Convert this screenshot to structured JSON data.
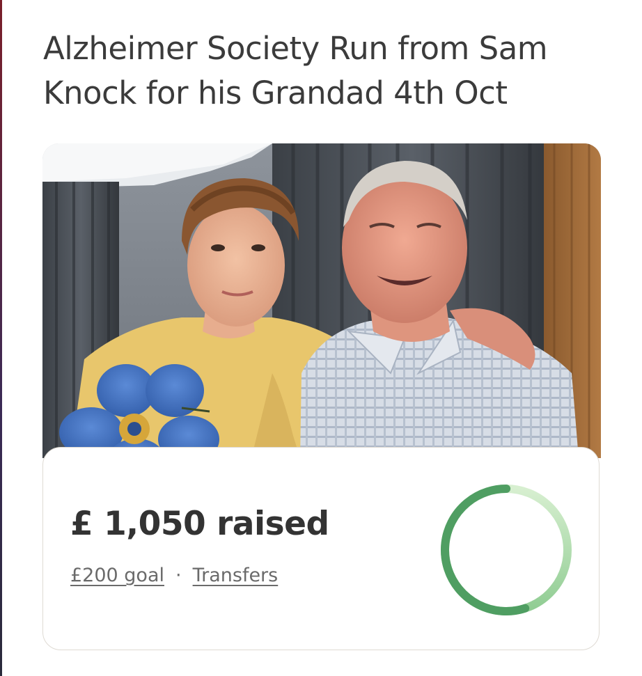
{
  "campaign": {
    "title": "Alzheimer Society Run from Sam Knock for his Grandad 4th Oct"
  },
  "progress": {
    "raised_text": "£ 1,050 raised",
    "goal_text": "£200 goal",
    "separator": "·",
    "transfers_text": "Transfers",
    "fraction": 1.0,
    "colors": {
      "start": "#4f9e62",
      "end": "#cbe9c2"
    }
  },
  "photo": {
    "description_icon": "photo-icon",
    "emblem": "forget-me-not-flower-icon"
  }
}
